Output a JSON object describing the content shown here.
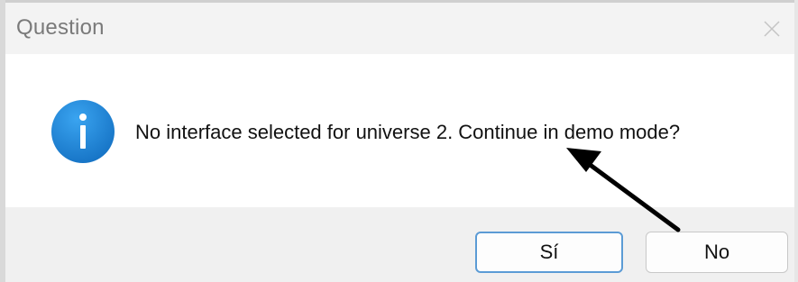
{
  "dialog": {
    "title": "Question",
    "message": "No interface selected for universe 2. Continue in demo mode?",
    "icon": "info-icon",
    "buttons": {
      "yes_label": "Sí",
      "no_label": "No"
    }
  },
  "annotation": {
    "icon": "arrow-icon",
    "color": "#000000"
  },
  "colors": {
    "accent": "#5b9bd5",
    "icon_blue": "#1f8ce0"
  }
}
